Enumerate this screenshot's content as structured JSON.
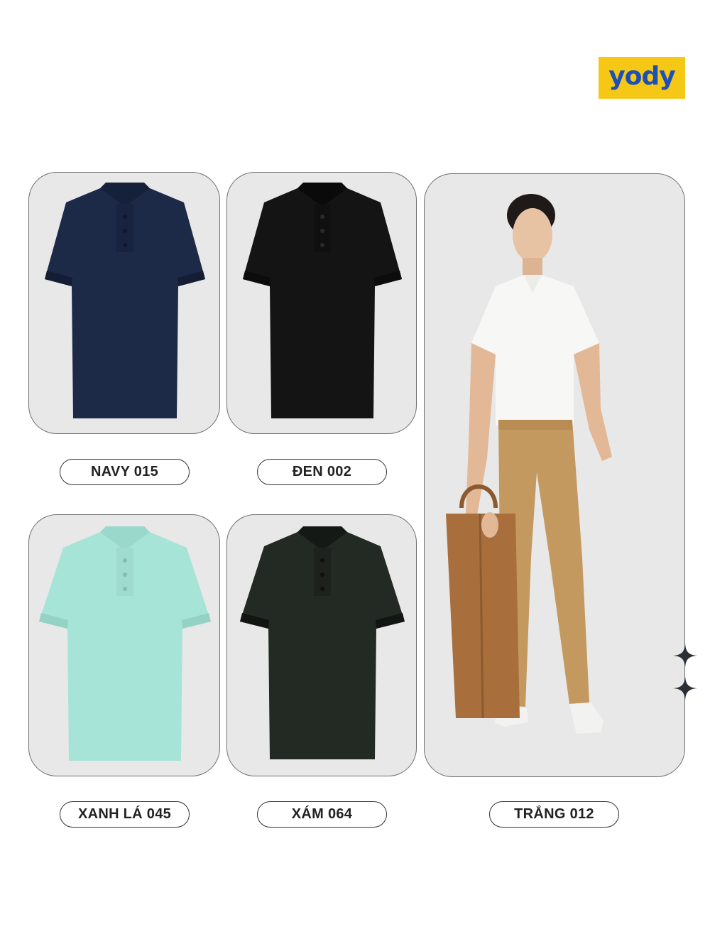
{
  "brand": {
    "logo_text": "yody",
    "logo_bg": "#f5c816",
    "logo_fg": "#1d4fb8"
  },
  "products": [
    {
      "label": "NAVY 015",
      "color": "#1c2a47"
    },
    {
      "label": "ĐEN 002",
      "color": "#141414"
    },
    {
      "label": "XANH LÁ 045",
      "color": "#a7e4d8"
    },
    {
      "label": "XÁM 064",
      "color": "#232923"
    },
    {
      "label": "TRẮNG 012",
      "color": "#f7f7f5"
    }
  ],
  "decor": {
    "icon": "four-point-star-icon"
  }
}
